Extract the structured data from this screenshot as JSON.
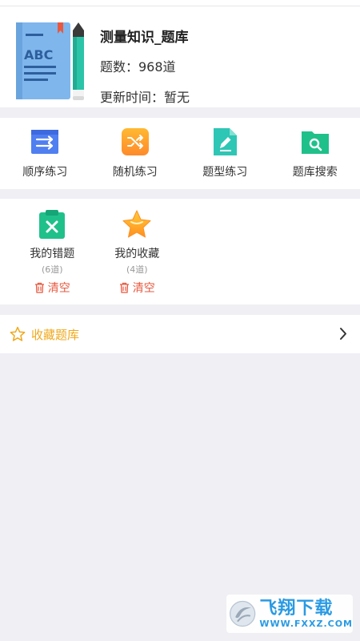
{
  "header": {
    "title": "测量知识_题库",
    "count": "题数：968道",
    "update": "更新时间：暂无",
    "cover_text": "ABC"
  },
  "practice": [
    {
      "label": "顺序练习",
      "icon": "sequential-practice-icon"
    },
    {
      "label": "随机练习",
      "icon": "shuffle-practice-icon"
    },
    {
      "label": "题型练习",
      "icon": "question-type-practice-icon"
    },
    {
      "label": "题库搜索",
      "icon": "bank-search-icon"
    }
  ],
  "records": [
    {
      "label": "我的错题",
      "count": "(6道)",
      "clear": "清空",
      "icon": "wrong-questions-icon"
    },
    {
      "label": "我的收藏",
      "count": "(4道)",
      "clear": "清空",
      "icon": "favorites-star-icon"
    }
  ],
  "favorites_row": {
    "label": "收藏题库",
    "icon": "star-outline-icon"
  },
  "watermark": {
    "brand": "飞翔下载",
    "url": "WWW.FXXZ.COM"
  },
  "colors": {
    "accent_orange": "#f0a91c",
    "danger_red": "#e8583f",
    "page_bg": "#efeff4",
    "watermark_blue": "#2a9ae3"
  }
}
